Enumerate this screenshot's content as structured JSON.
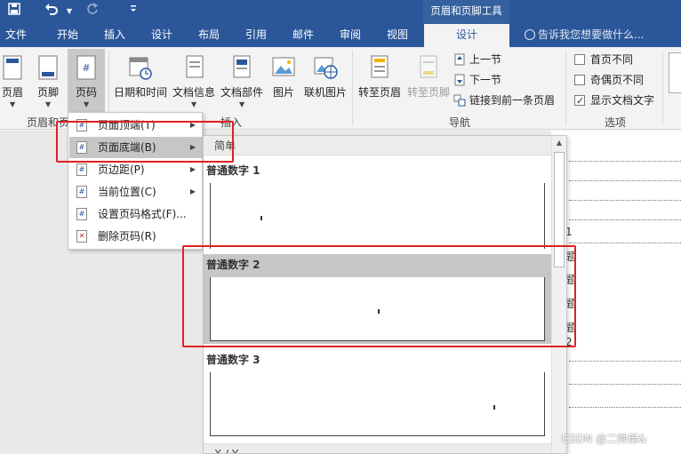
{
  "titlebar": {
    "save_icon": "save-icon",
    "undo_icon": "undo-icon",
    "redo_icon": "redo-icon",
    "customize_icon": "customize-qat-icon",
    "contextual_tab_group": "页眉和页脚工具"
  },
  "tabs": [
    {
      "label": "文件"
    },
    {
      "label": "开始"
    },
    {
      "label": "插入"
    },
    {
      "label": "设计"
    },
    {
      "label": "布局"
    },
    {
      "label": "引用"
    },
    {
      "label": "邮件"
    },
    {
      "label": "审阅"
    },
    {
      "label": "视图"
    },
    {
      "label": "设计",
      "active": true
    }
  ],
  "tell_me": "告诉我您想要做什么...",
  "ribbon": {
    "header_footer_group": {
      "label": "页眉和页脚",
      "header": "页眉",
      "footer": "页脚",
      "page_number": "页码"
    },
    "insert_group": {
      "label": "插入",
      "date_time": "日期和时间",
      "doc_info": "文档信息",
      "quick_parts": "文档部件",
      "picture": "图片",
      "online_picture": "联机图片"
    },
    "navigation_group": {
      "label": "导航",
      "goto_header": "转至页眉",
      "goto_footer": "转至页脚",
      "prev_section": "上一节",
      "next_section": "下一节",
      "link_previous": "链接到前一条页眉"
    },
    "options_group": {
      "label": "选项",
      "different_first": "首页不同",
      "different_odd_even": "奇偶页不同",
      "show_doc_text": "显示文档文字",
      "show_doc_text_checked": true
    }
  },
  "page_number_menu": [
    {
      "label": "页面顶端(T)",
      "has_submenu": true
    },
    {
      "label": "页面底端(B)",
      "has_submenu": true,
      "highlighted": true
    },
    {
      "label": "页边距(P)",
      "has_submenu": true
    },
    {
      "label": "当前位置(C)",
      "has_submenu": true
    },
    {
      "label": "设置页码格式(F)...",
      "has_submenu": false
    },
    {
      "label": "删除页码(R)",
      "has_submenu": false
    }
  ],
  "gallery": {
    "section_header": "简单",
    "items": [
      {
        "name": "普通数字 1"
      },
      {
        "name": "普通数字 2",
        "highlighted": true
      },
      {
        "name": "普通数字 3"
      }
    ],
    "next_section_header": "X / Y"
  },
  "document_bg": {
    "toc_fragments": [
      "1",
      "题",
      "题",
      "题",
      "题",
      "2"
    ]
  },
  "watermark": "CSDN @二帅弟&"
}
